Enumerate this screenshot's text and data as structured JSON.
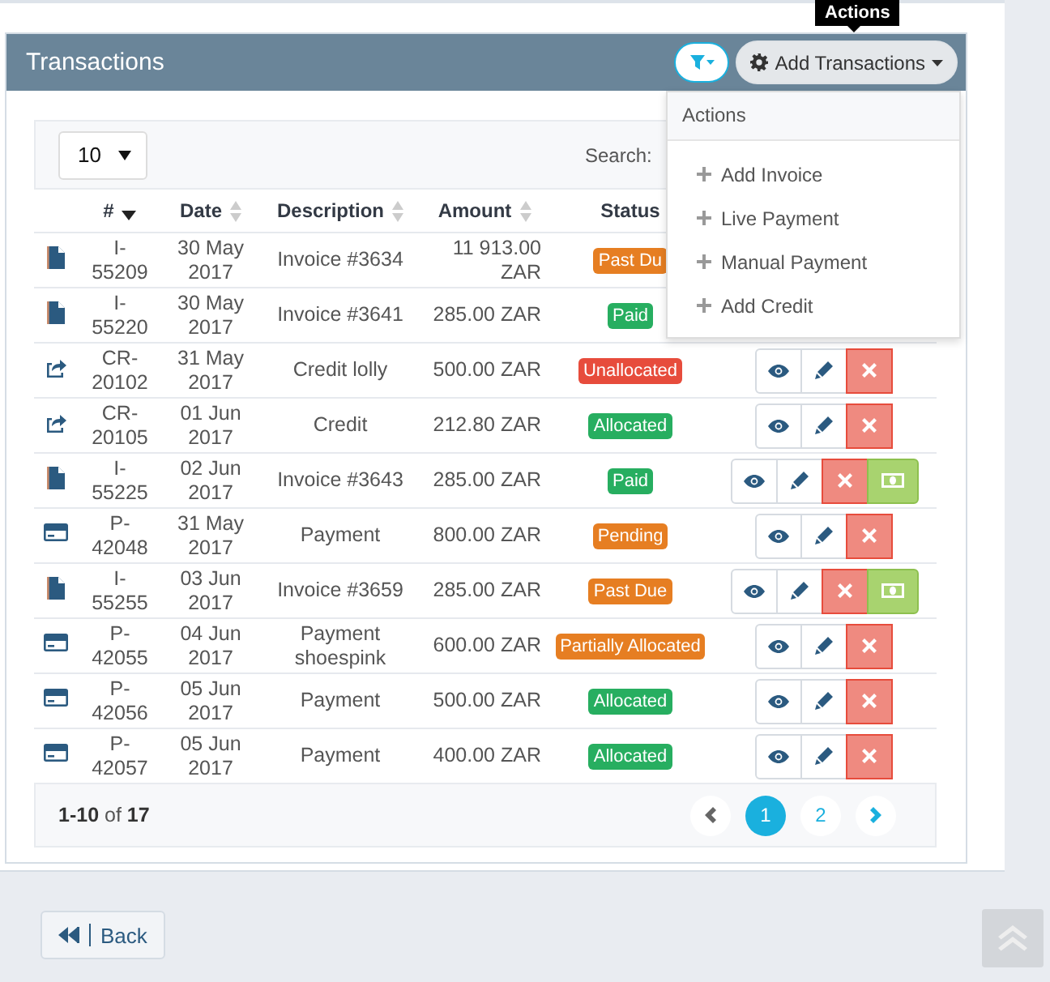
{
  "tooltip": {
    "text": "Actions"
  },
  "panel": {
    "title": "Transactions"
  },
  "add_button": {
    "label": "Add Transactions",
    "expanded": true
  },
  "dropdown": {
    "header": "Actions",
    "items": [
      "Add Invoice",
      "Live Payment",
      "Manual Payment",
      "Add Credit"
    ]
  },
  "page_size": "10",
  "search_label": "Search:",
  "columns": [
    {
      "label": "#",
      "kind": "sorted"
    },
    {
      "label": "Date",
      "kind": "sortable"
    },
    {
      "label": "Description",
      "kind": "sortable"
    },
    {
      "label": "Amount",
      "kind": "sortable"
    },
    {
      "label": "Status",
      "kind": "plain"
    }
  ],
  "rows": [
    {
      "kind": "invoice",
      "number": "I-55209",
      "date": "30 May 2017",
      "description": "Invoice #3634",
      "amount": "11 913.00 ZAR",
      "status": {
        "label": "Past Du",
        "color": "#e67e22"
      }
    },
    {
      "kind": "invoice",
      "number": "I-55220",
      "date": "30 May 2017",
      "description": "Invoice #3641",
      "amount": "285.00 ZAR",
      "status": {
        "label": "Paid",
        "color": "#27ae60"
      }
    },
    {
      "kind": "credit",
      "number": "CR-20102",
      "date": "31 May 2017",
      "description": "Credit lolly",
      "amount": "500.00 ZAR",
      "status": {
        "label": "Unallocated",
        "color": "#e74c3c"
      },
      "actions": [
        {
          "kind": "view"
        },
        {
          "kind": "edit"
        },
        {
          "kind": "delete"
        }
      ]
    },
    {
      "kind": "credit",
      "number": "CR-20105",
      "date": "01 Jun 2017",
      "description": "Credit",
      "amount": "212.80 ZAR",
      "status": {
        "label": "Allocated",
        "color": "#27ae60"
      },
      "actions": [
        {
          "kind": "view"
        },
        {
          "kind": "edit"
        },
        {
          "kind": "delete"
        }
      ]
    },
    {
      "kind": "invoice",
      "number": "I-55225",
      "date": "02 Jun 2017",
      "description": "Invoice #3643",
      "amount": "285.00 ZAR",
      "status": {
        "label": "Paid",
        "color": "#27ae60"
      },
      "actions": [
        {
          "kind": "view"
        },
        {
          "kind": "edit"
        },
        {
          "kind": "delete"
        },
        {
          "kind": "pay"
        }
      ]
    },
    {
      "kind": "payment",
      "number": "P-42048",
      "date": "31 May 2017",
      "description": "Payment",
      "amount": "800.00 ZAR",
      "status": {
        "label": "Pending",
        "color": "#e67e22"
      },
      "actions": [
        {
          "kind": "view"
        },
        {
          "kind": "edit"
        },
        {
          "kind": "delete"
        }
      ]
    },
    {
      "kind": "invoice",
      "number": "I-55255",
      "date": "03 Jun 2017",
      "description": "Invoice #3659",
      "amount": "285.00 ZAR",
      "status": {
        "label": "Past Due",
        "color": "#e67e22"
      },
      "actions": [
        {
          "kind": "view"
        },
        {
          "kind": "edit"
        },
        {
          "kind": "delete"
        },
        {
          "kind": "pay"
        }
      ]
    },
    {
      "kind": "payment",
      "number": "P-42055",
      "date": "04 Jun 2017",
      "description": "Payment shoespink",
      "amount": "600.00 ZAR",
      "status": {
        "label": "Partially Allocated",
        "color": "#e67e22"
      },
      "actions": [
        {
          "kind": "view"
        },
        {
          "kind": "edit"
        },
        {
          "kind": "delete"
        }
      ]
    },
    {
      "kind": "payment",
      "number": "P-42056",
      "date": "05 Jun 2017",
      "description": "Payment",
      "amount": "500.00 ZAR",
      "status": {
        "label": "Allocated",
        "color": "#27ae60"
      },
      "actions": [
        {
          "kind": "view"
        },
        {
          "kind": "edit"
        },
        {
          "kind": "delete"
        }
      ]
    },
    {
      "kind": "payment",
      "number": "P-42057",
      "date": "05 Jun 2017",
      "description": "Payment",
      "amount": "400.00 ZAR",
      "status": {
        "label": "Allocated",
        "color": "#27ae60"
      },
      "actions": [
        {
          "kind": "view"
        },
        {
          "kind": "edit"
        },
        {
          "kind": "delete"
        }
      ]
    }
  ],
  "footer": {
    "summary": "**1-10** of **17**"
  },
  "pagination": [
    {
      "label": "1",
      "selected": true
    },
    {
      "label": "2",
      "selected": false
    }
  ],
  "back_button": {
    "label": "Back"
  }
}
